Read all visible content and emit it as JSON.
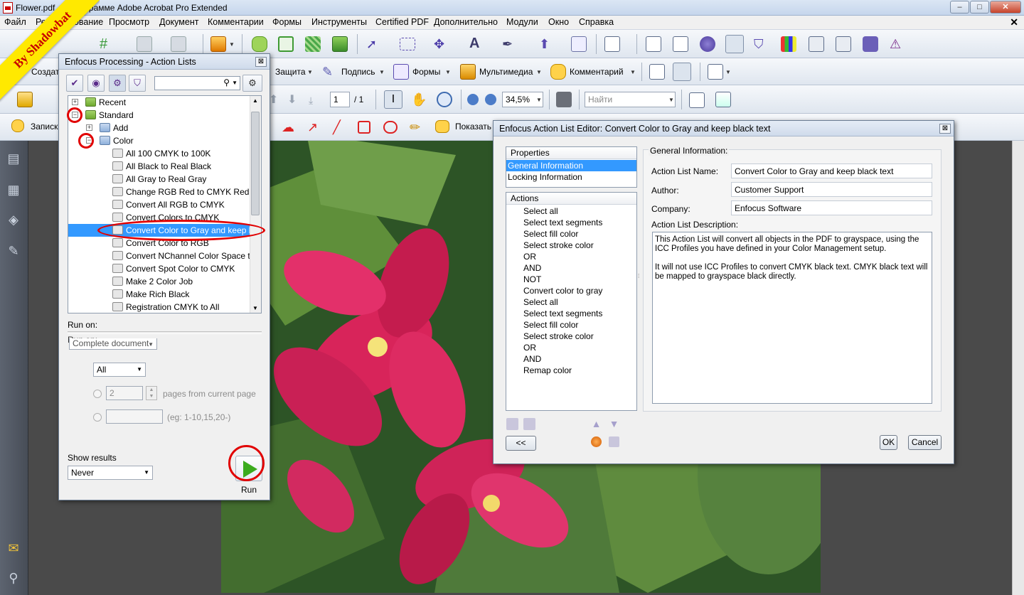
{
  "window": {
    "title": "Flower.pdf - О программе Adobe Acrobat Pro Extended",
    "minimize": "–",
    "maximize": "□",
    "close": "✕",
    "doc_close": "✕"
  },
  "menu": [
    "Файл",
    "Редактирование",
    "Просмотр",
    "Документ",
    "Комментарии",
    "Формы",
    "Инструменты",
    "Certified PDF",
    "Дополнительно",
    "Модули",
    "Окно",
    "Справка"
  ],
  "toolbar2": {
    "create": "Создать",
    "protect": "Защита",
    "sign": "Подпись",
    "forms": "Формы",
    "multimedia": "Мультимедиа",
    "comment": "Комментарий"
  },
  "toolbar3": {
    "page_current": "1",
    "page_total": "/ 1",
    "zoom": "34,5%",
    "find_placeholder": "Найти"
  },
  "toolbar4": {
    "record": "Записк",
    "show": "Показать"
  },
  "watermark": "By Shadowbat",
  "processing": {
    "title": "Enfocus Processing - Action Lists",
    "close": "⊠",
    "tree": [
      {
        "label": "Recent",
        "level": 0,
        "box": "+",
        "icon": "fold"
      },
      {
        "label": "Standard",
        "level": 0,
        "box": "−",
        "icon": "fold"
      },
      {
        "label": "Add",
        "level": 1,
        "box": "+",
        "icon": "bfold"
      },
      {
        "label": "Color",
        "level": 1,
        "box": "−",
        "icon": "bfold"
      },
      {
        "label": "All 100 CMYK to 100K",
        "level": 2,
        "icon": "gear"
      },
      {
        "label": "All Black to Real Black",
        "level": 2,
        "icon": "gear"
      },
      {
        "label": "All Gray to Real Gray",
        "level": 2,
        "icon": "gear"
      },
      {
        "label": "Change RGB Red to CMYK Red",
        "level": 2,
        "icon": "gear"
      },
      {
        "label": "Convert All RGB to CMYK",
        "level": 2,
        "icon": "gear"
      },
      {
        "label": "Convert Colors to CMYK",
        "level": 2,
        "icon": "gear"
      },
      {
        "label": "Convert Color to Gray and keep blac",
        "level": 2,
        "icon": "gear",
        "selected": true
      },
      {
        "label": "Convert Color to RGB",
        "level": 2,
        "icon": "gear"
      },
      {
        "label": "Convert NChannel Color Space to De",
        "level": 2,
        "icon": "gear"
      },
      {
        "label": "Convert Spot Color to CMYK",
        "level": 2,
        "icon": "gear"
      },
      {
        "label": "Make 2 Color Job",
        "level": 2,
        "icon": "gear"
      },
      {
        "label": "Make Rich Black",
        "level": 2,
        "icon": "gear"
      },
      {
        "label": "Registration CMYK to All",
        "level": 2,
        "icon": "gear"
      }
    ],
    "run_on_label": "Run on:",
    "run_on_label2": "Run on:",
    "run_on_value": "Complete document",
    "all_value": "All",
    "pages_value": "2",
    "pages_label": "pages from current page",
    "range_label": "(eg: 1-10,15,20-)",
    "show_results_label": "Show results",
    "show_results_value": "Never",
    "run_label": "Run"
  },
  "editor": {
    "title": "Enfocus Action List Editor: Convert Color to Gray and keep black text",
    "close": "⊠",
    "properties_header": "Properties",
    "properties": [
      "General Information",
      "Locking Information"
    ],
    "actions_header": "Actions",
    "actions": [
      "Select all",
      "Select text segments",
      "Select fill color",
      "Select stroke color",
      "OR",
      "AND",
      "NOT",
      "Convert color to gray",
      "Select all",
      "Select text segments",
      "Select fill color",
      "Select stroke color",
      "OR",
      "AND",
      "Remap color"
    ],
    "group_label": "General Information:",
    "name_label": "Action List Name:",
    "name_value": "Convert Color to Gray and keep black text",
    "author_label": "Author:",
    "author_value": "Customer Support",
    "company_label": "Company:",
    "company_value": "Enfocus Software",
    "desc_label": "Action List Description:",
    "desc_p1": "This Action List will convert all objects in the PDF to grayspace, using the ICC Profiles you have defined in your Color Management setup.",
    "desc_p2": "It will not use ICC Profiles to convert CMYK black text. CMYK black text will be mapped to grayspace black directly.",
    "back_button": "<<",
    "ok_button": "OK",
    "cancel_button": "Cancel"
  },
  "colors": {
    "accent_select": "#3399ff",
    "highlight_circle": "#e10000",
    "run_green": "#3bab1e"
  }
}
